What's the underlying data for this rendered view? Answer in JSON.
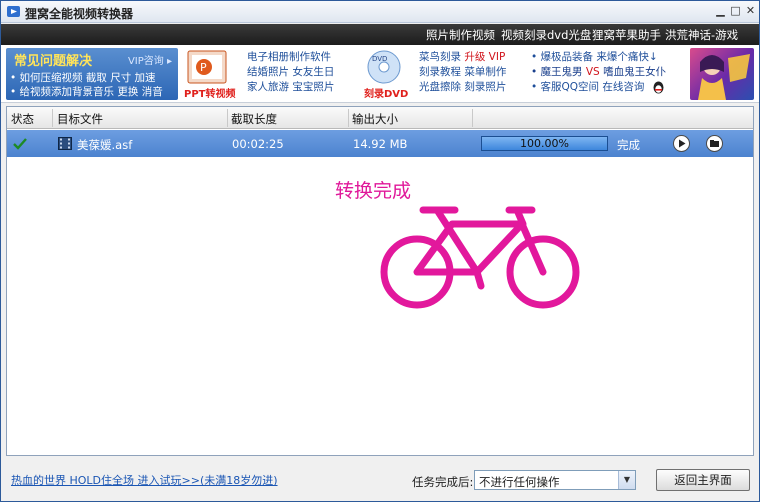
{
  "window": {
    "title": "狸窝全能视频转换器"
  },
  "topbar": {
    "links": [
      "照片制作视频",
      "视频刻录dvd光盘",
      "狸窝苹果助手",
      "洪荒神话-游戏"
    ]
  },
  "banner": {
    "faq_title": "常见问题解决",
    "vip": "VIP咨询 ▸",
    "faq_line1": "• 如何压缩视频 截取 尺寸 加速",
    "faq_line2": "• 给视频添加背景音乐 更换 消音",
    "ppt_label": "PPT转视频",
    "col1": [
      "电子相册制作软件",
      "结婚照片 女友生日",
      "家人旅游 宝宝照片"
    ],
    "dvd_label": "刻录DVD",
    "col2_line1_a": "菜鸟刻录 ",
    "col2_line1_b": "升级 VIP",
    "col2_line2": "刻录教程 菜单制作",
    "col2_line3": "光盘擦除 刻录照片",
    "col3_line1": "• 爆极品装备 来爆个痛快↓",
    "col3_line2_a": "• 魔王鬼男 ",
    "col3_line2_b": "VS",
    "col3_line2_c": " 嗜血鬼王女仆",
    "col3_line3": "• 客服QQ空间 在线咨询"
  },
  "table": {
    "headers": [
      "状态",
      "目标文件",
      "截取长度",
      "输出大小"
    ],
    "rows": [
      {
        "file": "美葆媛.asf",
        "duration": "00:02:25",
        "size": "14.92 MB",
        "progress_text": "100.00%",
        "progress": 1.0,
        "status": "完成"
      }
    ]
  },
  "result": {
    "text": "转换完成"
  },
  "footer": {
    "link": "热血的世界 HOLD住全场 进入试玩>>(未满18岁勿进)",
    "after_label": "任务完成后:",
    "after_value": "不进行任何操作",
    "back_button": "返回主界面"
  },
  "colors": {
    "accent": "#4c83cf",
    "done_pink": "#e0189a",
    "link_blue": "#1f4f9a"
  }
}
